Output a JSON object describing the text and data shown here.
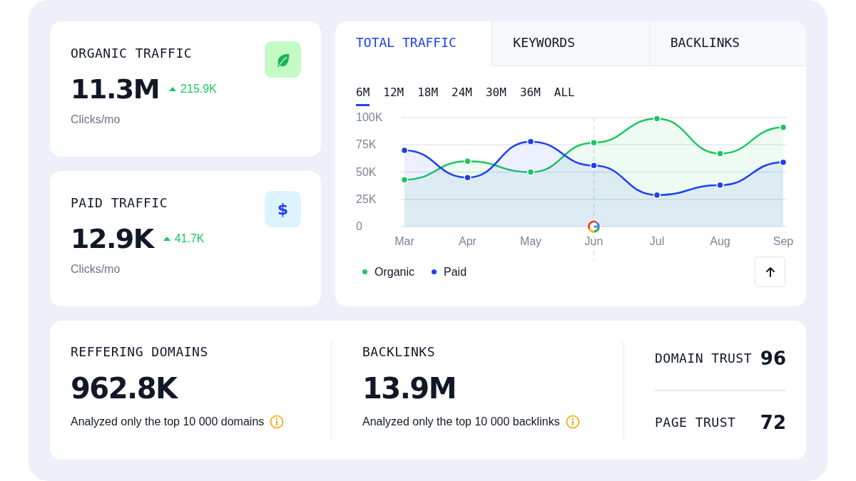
{
  "stat_cards": [
    {
      "kind": "organic",
      "title": "ORGANIC TRAFFIC",
      "value": "11.3M",
      "change": "215.9K",
      "unit": "Clicks/mo"
    },
    {
      "kind": "paid",
      "symbol": "$",
      "title": "PAID TRAFFIC",
      "value": "12.9K",
      "change": "41.7K",
      "unit": "Clicks/mo"
    }
  ],
  "traffic_panel": {
    "tabs": [
      {
        "label": "TOTAL TRAFFIC",
        "selected": true
      },
      {
        "label": "KEYWORDS",
        "selected": false
      },
      {
        "label": "BACKLINKS",
        "selected": false
      }
    ],
    "periods": [
      {
        "label": "6M",
        "selected": true
      },
      {
        "label": "12M",
        "selected": false
      },
      {
        "label": "18M",
        "selected": false
      },
      {
        "label": "24M",
        "selected": false
      },
      {
        "label": "30M",
        "selected": false
      },
      {
        "label": "36M",
        "selected": false
      },
      {
        "label": "ALL",
        "selected": false
      }
    ],
    "chart_data": {
      "type": "area",
      "grid": true,
      "categories": [
        "Mar",
        "Apr",
        "May",
        "Jun",
        "Jul",
        "Aug",
        "Sep"
      ],
      "ylim": [
        0,
        100000
      ],
      "yticks": [
        {
          "value": 0,
          "label": "0"
        },
        {
          "value": 25000,
          "label": "25K"
        },
        {
          "value": 50000,
          "label": "50K"
        },
        {
          "value": 75000,
          "label": "75K"
        },
        {
          "value": 100000,
          "label": "100K"
        }
      ],
      "series": [
        {
          "name": "Organic",
          "color": "#1cc65f",
          "values": [
            43000,
            60000,
            50000,
            77000,
            99000,
            67000,
            91000
          ]
        },
        {
          "name": "Paid",
          "color": "#1f3ff0",
          "values": [
            70000,
            45000,
            78000,
            56000,
            29000,
            38000,
            59000
          ]
        }
      ],
      "ref_lines": [
        {
          "axis": "x",
          "value": "Jun"
        }
      ]
    }
  },
  "summary": {
    "metrics": [
      {
        "title": "REFFERING DOMAINS",
        "value": "962.8K",
        "note": "Analyzed only the top 10 000 domains"
      },
      {
        "title": "BACKLINKS",
        "value": "13.9M",
        "note": "Analyzed only the top 10 000 backlinks"
      }
    ],
    "trust": [
      {
        "label": "DOMAIN TRUST",
        "value": "96"
      },
      {
        "label": "PAGE TRUST",
        "value": "72"
      }
    ]
  }
}
